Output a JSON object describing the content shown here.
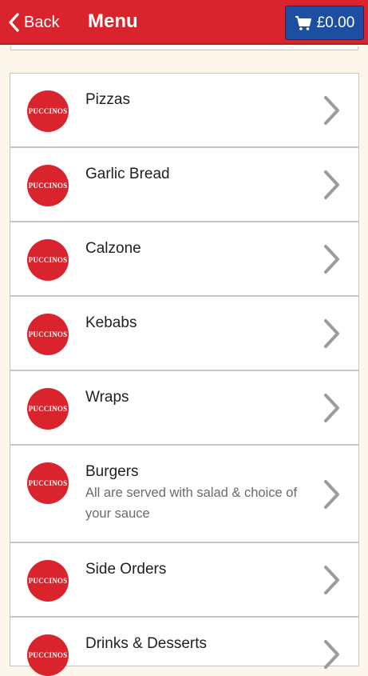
{
  "header": {
    "back_label": "Back",
    "title": "Menu",
    "cart_total": "£0.00"
  },
  "brand_logo_text": "PUCCINOS",
  "colors": {
    "header_red": "#d9232d",
    "cart_blue": "#1c4fa0",
    "background": "#fdf6ea"
  },
  "categories": [
    {
      "name": "Pizzas",
      "description": ""
    },
    {
      "name": "Garlic Bread",
      "description": ""
    },
    {
      "name": "Calzone",
      "description": ""
    },
    {
      "name": "Kebabs",
      "description": ""
    },
    {
      "name": "Wraps",
      "description": ""
    },
    {
      "name": "Burgers",
      "description": "All are served with salad & choice of your sauce"
    },
    {
      "name": "Side Orders",
      "description": ""
    },
    {
      "name": "Drinks & Desserts",
      "description": ""
    }
  ]
}
